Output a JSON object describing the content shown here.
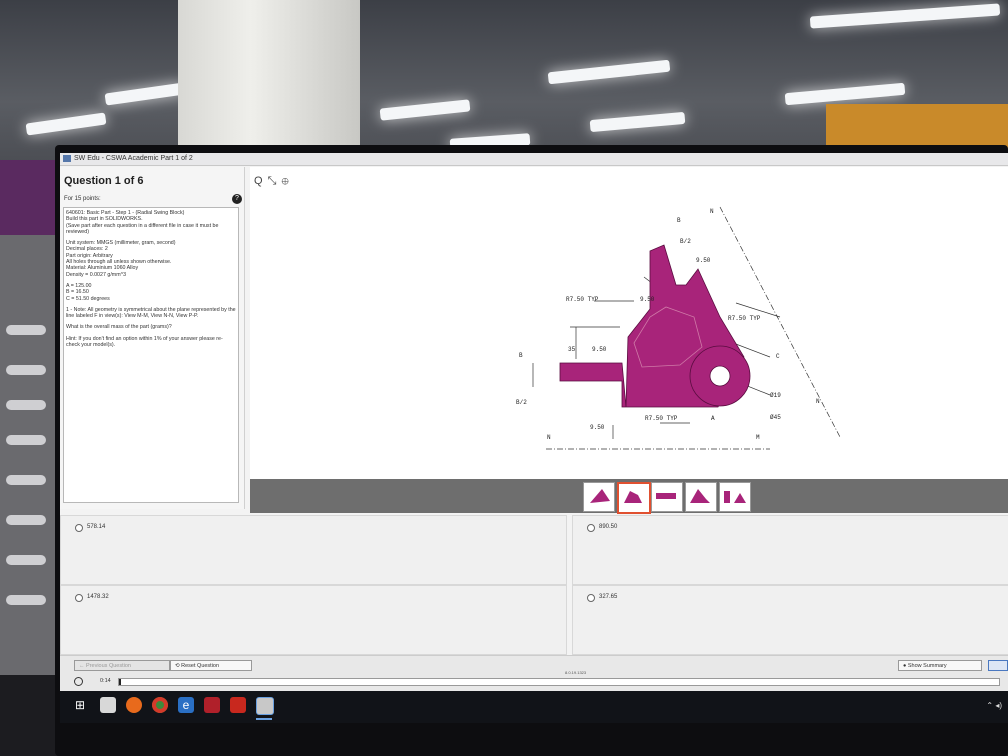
{
  "window": {
    "title": "SW Edu - CSWA Academic Part 1 of 2"
  },
  "question": {
    "heading": "Question 1 of 6",
    "points": "For 15 points:",
    "body": [
      "640601: Basic Part - Step 1 - (Radial Swing Block)\nBuild this part in SOLIDWORKS.\n(Save part after each question in a different file in case it must be reviewed)",
      "Unit system: MMGS (millimeter, gram, second)\nDecimal places: 2\nPart origin: Arbitrary\nAll holes through all unless shown otherwise.\nMaterial: Aluminium 1060 Alloy\nDensity = 0.0027 g/mm^3",
      "A = 125.00\nB = 16.50\nC = 51.50 degrees",
      "1 - Note: All geometry is symmetrical about the plane represented by the line labeled F in view(s): View M-M, View N-N, View P-P.",
      "What is the overall mass of the part (grams)?",
      "Hint: If you don't find an option within 1% of your answer please re-check your model(s)."
    ]
  },
  "viewer": {
    "zoom_label": "Q ⤡ ⊕",
    "labels": {
      "b_top": "B",
      "b_half_top": "B/2",
      "b_left": "B",
      "b_half_left": "B/2",
      "d950a": "9.50",
      "d950b": "9.50",
      "d950c": "9.50",
      "d950d": "9.50",
      "d35": "35",
      "r750_left": "R7.50 TYP",
      "r750_right": "R7.50 TYP",
      "r750_bottom": "R7.50 TYP",
      "dia19": "Ø19",
      "dia45": "Ø45",
      "n_top": "N",
      "n_right": "N",
      "n_left": "N",
      "m_right": "M",
      "c": "C",
      "a": "A"
    }
  },
  "answers": [
    {
      "value": "578.14"
    },
    {
      "value": "890.50"
    },
    {
      "value": "1478.32"
    },
    {
      "value": "327.65"
    }
  ],
  "footer": {
    "prev": "Previous Question",
    "reset": "Reset Question",
    "summary": "Show Summary",
    "timer": "0:14",
    "version": "8.0.19.1323"
  },
  "colors": {
    "part": "#a8247a",
    "accent": "#e05030"
  }
}
